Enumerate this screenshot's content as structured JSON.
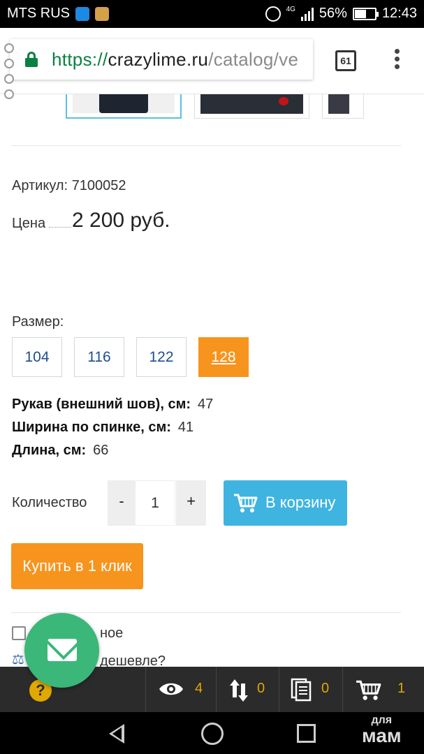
{
  "status_bar": {
    "carrier": "MTS RUS",
    "network": "4G",
    "battery": "56%",
    "battery_level": 0.56,
    "time": "12:43"
  },
  "browser": {
    "url_scheme": "https://",
    "url_host": "crazylime.ru",
    "url_path": "/catalog/vе",
    "tab_count": "61"
  },
  "product": {
    "article_label": "Артикул:",
    "article_value": "7100052",
    "price_label": "Цена",
    "price_value": "2 200 руб.",
    "size_label": "Размер:",
    "sizes": [
      "104",
      "116",
      "122",
      "128"
    ],
    "selected_size": "128",
    "specs": [
      {
        "label": "Рукав (внешний шов), см:",
        "value": "47"
      },
      {
        "label": "Ширина по спинке, см:",
        "value": "41"
      },
      {
        "label": "Длина, см:",
        "value": "66"
      }
    ],
    "quantity_label": "Количество",
    "quantity_minus": "-",
    "quantity_value": "1",
    "quantity_plus": "+",
    "cart_button": "В корзину",
    "buy_one_click": "Купить в 1 клик",
    "checkbox_label_partial": "ное",
    "cheaper_partial": "дешевле?"
  },
  "toolbar": {
    "help": "?",
    "viewed_count": "4",
    "compare_count": "0",
    "list_count": "0",
    "cart_count": "1",
    "accent": "#e0a800"
  },
  "watermark": {
    "line1": "для",
    "line2": "мам"
  },
  "colors": {
    "orange": "#f7941d",
    "blue": "#3fb4e0",
    "green": "#3bb779",
    "url_green": "#0b8043"
  }
}
